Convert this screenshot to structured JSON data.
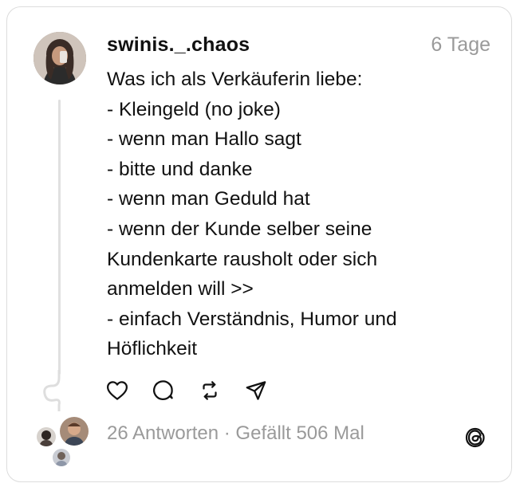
{
  "post": {
    "username": "swinis._.chaos",
    "time": "6 Tage",
    "text": "Was ich als Verkäuferin liebe:\n- Kleingeld (no joke)\n- wenn man Hallo sagt\n- bitte und danke\n- wenn man Geduld hat\n- wenn der Kunde selber seine\nKundenkarte rausholt oder sich\nanmelden will >>\n- einfach Verständnis, Humor und\nHöflichkeit"
  },
  "footer": {
    "meta": "26 Antworten · Gefällt 506 Mal"
  },
  "icons": {
    "like": "heart-icon",
    "reply": "comment-icon",
    "repost": "repost-icon",
    "share": "send-icon",
    "brand": "threads-logo"
  },
  "colors": {
    "text": "#111111",
    "muted": "#9a9a9a",
    "border": "#dcdcdc"
  }
}
